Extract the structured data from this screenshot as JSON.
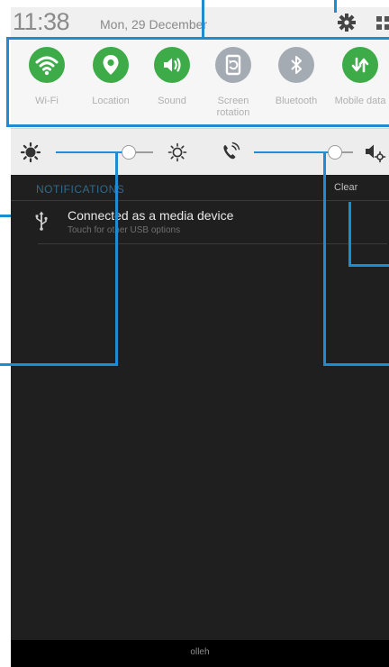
{
  "status_bar": {
    "time": "11:38",
    "date": "Mon, 29 December",
    "icons": [
      "gear-icon",
      "grid-edit-icon"
    ]
  },
  "quick_settings": [
    {
      "id": "wifi",
      "label": "Wi-Fi",
      "icon": "wifi-icon",
      "active": true,
      "color": "#3dab48"
    },
    {
      "id": "location",
      "label": "Location",
      "icon": "location-pin-icon",
      "active": true,
      "color": "#3dab48"
    },
    {
      "id": "sound",
      "label": "Sound",
      "icon": "speaker-icon",
      "active": true,
      "color": "#3dab48"
    },
    {
      "id": "screen_rotation",
      "label": "Screen rotation",
      "icon": "screen-rotation-icon",
      "active": false,
      "color": "#a4abb3"
    },
    {
      "id": "bluetooth",
      "label": "Bluetooth",
      "icon": "bluetooth-icon",
      "active": false,
      "color": "#a4abb3"
    },
    {
      "id": "mobile_data",
      "label": "Mobile data",
      "icon": "mobile-data-icon",
      "active": true,
      "color": "#3dab48"
    }
  ],
  "sliders": {
    "brightness": {
      "value": 0.75,
      "icons": [
        "brightness-low-icon",
        "brightness-high-icon"
      ]
    },
    "volume": {
      "value": 0.82,
      "icons": [
        "ringtone-volume-icon",
        "volume-settings-icon"
      ]
    }
  },
  "notifications": {
    "header": "NOTIFICATIONS",
    "clear_label": "Clear",
    "items": [
      {
        "icon": "usb-icon",
        "title": "Connected as a media device",
        "subtitle": "Touch for other USB options"
      }
    ]
  },
  "bottom_bar": {
    "carrier": "olleh"
  },
  "colors": {
    "accent": "#1d8cd2",
    "active_toggle": "#3dab48",
    "inactive_toggle": "#a4abb3",
    "panel_bg": "#1f1f1f",
    "slider_track": "#1e8fd6"
  }
}
